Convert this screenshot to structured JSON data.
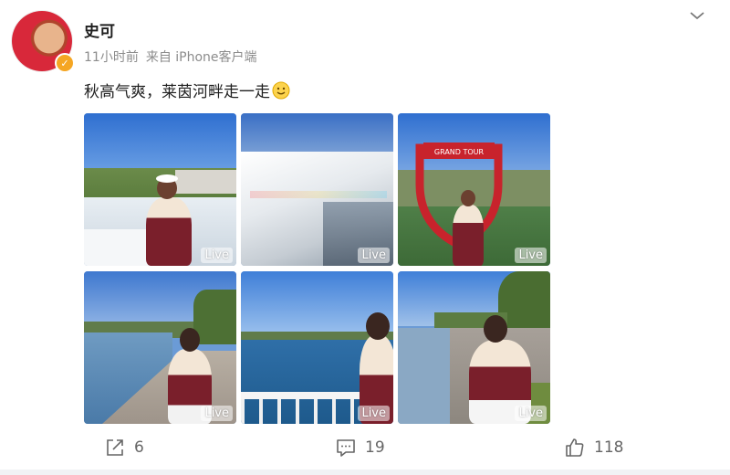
{
  "post": {
    "username": "史可",
    "time": "11小时前",
    "source": "来自 iPhone客户端",
    "text": "秋高气爽，莱茵河畔走一走",
    "emoji": "smiley-emoji",
    "verified_icon": "verified-badge-icon",
    "verified_color": "#f5a623"
  },
  "photos": [
    {
      "live_label": "Live",
      "scene": "woman-at-waterfall"
    },
    {
      "live_label": "Live",
      "scene": "waterfall-rainbow"
    },
    {
      "live_label": "Live",
      "scene": "grand-tour-frame"
    },
    {
      "live_label": "Live",
      "scene": "woman-on-shore"
    },
    {
      "live_label": "Live",
      "scene": "woman-by-river-railing"
    },
    {
      "live_label": "Live",
      "scene": "woman-on-path"
    }
  ],
  "frame_sign_text": "GRAND TOUR",
  "actions": {
    "share": {
      "icon": "share-icon",
      "count": "6"
    },
    "comment": {
      "icon": "comment-icon",
      "count": "19"
    },
    "like": {
      "icon": "thumbs-up-icon",
      "count": "118"
    }
  }
}
